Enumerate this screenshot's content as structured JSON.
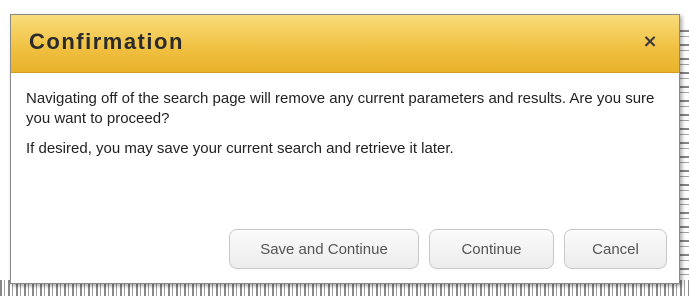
{
  "dialog": {
    "title": "Confirmation",
    "close_glyph": "×",
    "message_1": "Navigating off of the search page will remove any current parameters and results. Are you sure you want to proceed?",
    "message_2": "If desired, you may save your current search and retrieve it later.",
    "buttons": {
      "save_continue": "Save and Continue",
      "continue": "Continue",
      "cancel": "Cancel"
    }
  },
  "colors": {
    "titlebar_top": "#f8dc7a",
    "titlebar_bottom": "#e9b22b",
    "button_text": "#555555"
  },
  "icons": {
    "close": "close-icon"
  }
}
